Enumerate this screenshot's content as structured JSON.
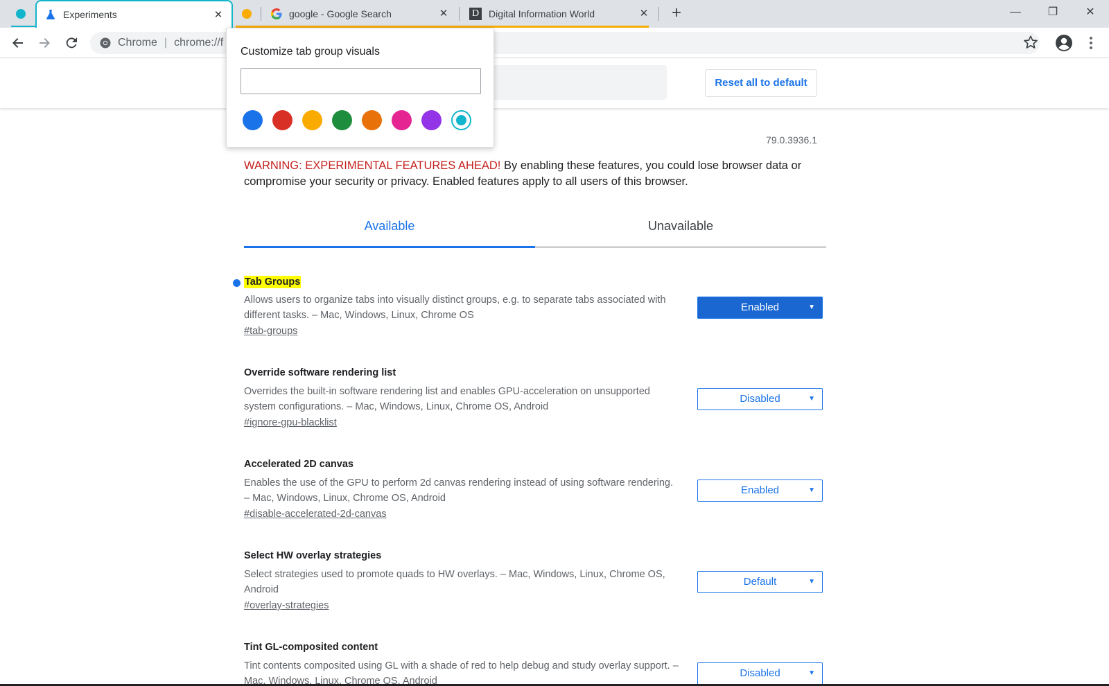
{
  "tabs": [
    {
      "title": "Experiments",
      "close": "✕",
      "icon": "flask-icon"
    },
    {
      "title": "google - Google Search",
      "close": "✕",
      "icon": "google-g-icon"
    },
    {
      "title": "Digital Information World",
      "close": "✕",
      "icon": "letter-d-icon",
      "favicon_letter": "D"
    }
  ],
  "tab_groups": [
    {
      "color": "#12b5cb"
    },
    {
      "color": "#f9ab00"
    }
  ],
  "newtab_label": "+",
  "window_controls": {
    "minimize": "—",
    "maximize": "❐",
    "close": "✕"
  },
  "omnibox": {
    "chip": "Chrome",
    "separator": "|",
    "url": "chrome://f"
  },
  "popup": {
    "title": "Customize tab group visuals",
    "input_value": "",
    "colors": [
      "#1a73e8",
      "#d93025",
      "#f9ab00",
      "#1e8e3e",
      "#e8710a",
      "#e52592",
      "#9334e6",
      "#12b5cb"
    ],
    "selected_color": "#12b5cb"
  },
  "header": {
    "reset_label": "Reset all to default"
  },
  "version": "79.0.3936.1",
  "warning": {
    "strong": "WARNING: EXPERIMENTAL FEATURES AHEAD!",
    "text": " By enabling these features, you could lose browser data or compromise your security or privacy. Enabled features apply to all users of this browser."
  },
  "content_tabs": {
    "available": "Available",
    "unavailable": "Unavailable"
  },
  "flags": [
    {
      "name": "Tab Groups",
      "desc": "Allows users to organize tabs into visually distinct groups, e.g. to separate tabs associated with different tasks. – Mac, Windows, Linux, Chrome OS",
      "link": "#tab-groups",
      "value": "Enabled",
      "caret": "▼"
    },
    {
      "name": "Override software rendering list",
      "desc": "Overrides the built-in software rendering list and enables GPU-acceleration on unsupported system configurations. – Mac, Windows, Linux, Chrome OS, Android",
      "link": "#ignore-gpu-blacklist",
      "value": "Disabled",
      "caret": "▼"
    },
    {
      "name": "Accelerated 2D canvas",
      "desc": "Enables the use of the GPU to perform 2d canvas rendering instead of using software rendering. – Mac, Windows, Linux, Chrome OS, Android",
      "link": "#disable-accelerated-2d-canvas",
      "value": "Enabled",
      "caret": "▼"
    },
    {
      "name": "Select HW overlay strategies",
      "desc": "Select strategies used to promote quads to HW overlays. – Mac, Windows, Linux, Chrome OS, Android",
      "link": "#overlay-strategies",
      "value": "Default",
      "caret": "▼"
    },
    {
      "name": "Tint GL-composited content",
      "desc": "Tint contents composited using GL with a shade of red to help debug and study overlay support. – Mac, Windows, Linux, Chrome OS, Android",
      "link": "",
      "value": "Disabled",
      "caret": "▼"
    }
  ]
}
